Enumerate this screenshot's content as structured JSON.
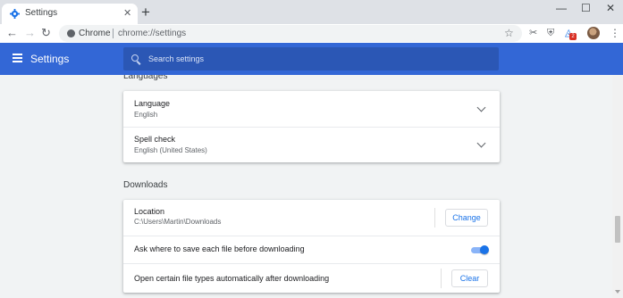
{
  "browser": {
    "tab": {
      "title": "Settings",
      "close_glyph": "✕",
      "favicon": "gear-icon"
    },
    "new_tab_glyph": "+",
    "window_controls": {
      "minimize": "—",
      "maximize": "☐",
      "close": "✕"
    },
    "toolbar": {
      "back": "←",
      "forward": "→",
      "reload": "↻",
      "site_chip": "Chrome",
      "url": "chrome://settings",
      "star": "☆",
      "extensions": [
        "✂",
        "⛨",
        "◬"
      ],
      "badge": "2",
      "more": "⋮"
    }
  },
  "header": {
    "title": "Settings",
    "search_placeholder": "Search settings",
    "color": "#3367d6"
  },
  "languages": {
    "title": "Languages",
    "rows": [
      {
        "label": "Language",
        "value": "English"
      },
      {
        "label": "Spell check",
        "value": "English (United States)"
      }
    ]
  },
  "downloads": {
    "title": "Downloads",
    "location": {
      "label": "Location",
      "value": "C:\\Users\\Martin\\Downloads",
      "button": "Change"
    },
    "ask_where": {
      "label": "Ask where to save each file before downloading",
      "enabled": true
    },
    "auto_open": {
      "label": "Open certain file types automatically after downloading",
      "button": "Clear"
    }
  }
}
